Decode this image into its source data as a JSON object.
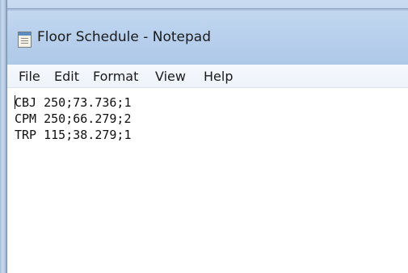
{
  "window": {
    "title": "Floor Schedule - Notepad"
  },
  "menu": {
    "file": "File",
    "edit": "Edit",
    "format": "Format",
    "view": "View",
    "help": "Help"
  },
  "document": {
    "lines": [
      "CBJ 250;73.736;1",
      "CPM 250;66.279;2",
      "TRP 115;38.279;1"
    ]
  },
  "colors": {
    "titlebar": "#bcd3ee",
    "menubar": "#f6f9fd",
    "text": "#101010"
  },
  "icons": {
    "app": "notepad-icon"
  }
}
